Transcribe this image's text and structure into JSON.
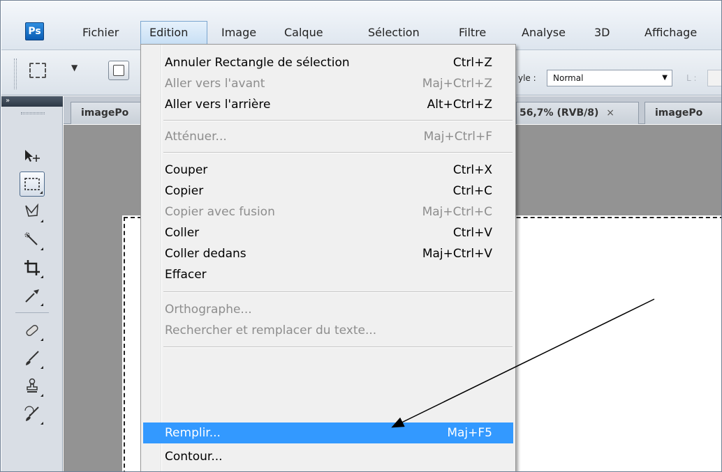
{
  "app": {
    "logo_text": "Ps",
    "menus": [
      "Fichier",
      "Edition",
      "Image",
      "Calque",
      "Sélection",
      "Filtre",
      "Analyse",
      "3D",
      "Affichage"
    ],
    "active_menu": "Edition"
  },
  "options_bar": {
    "style_label": "yle :",
    "style_value": "Normal",
    "width_label": "L :",
    "tool_preset_icon": "rect-marquee-icon",
    "mode_icon": "new-selection-icon"
  },
  "tabs": {
    "left_tab": "imagePo",
    "middle_tab": "56,7% (RVB/8)",
    "middle_tab_close": "×",
    "right_tab": "imagePo"
  },
  "tools_panel": {
    "header": "»",
    "tools": [
      {
        "name": "move-tool-icon",
        "glyph": "▶"
      },
      {
        "name": "rectangular-marquee-tool-icon",
        "glyph": "⬚"
      },
      {
        "name": "lasso-tool-icon",
        "glyph": "ᐯ"
      },
      {
        "name": "quick-selection-tool-icon",
        "glyph": "⁄"
      },
      {
        "name": "crop-tool-icon",
        "glyph": "⌗"
      },
      {
        "name": "eyedropper-tool-icon",
        "glyph": "⁄"
      },
      {
        "name": "healing-brush-tool-icon",
        "glyph": "⊘"
      },
      {
        "name": "brush-tool-icon",
        "glyph": "⁄"
      },
      {
        "name": "clone-stamp-tool-icon",
        "glyph": "♙"
      },
      {
        "name": "history-brush-tool-icon",
        "glyph": "⁄"
      }
    ]
  },
  "edit_menu": {
    "items": [
      {
        "label": "Annuler Rectangle de sélection",
        "shortcut": "Ctrl+Z",
        "enabled": true
      },
      {
        "label": "Aller vers l'avant",
        "shortcut": "Maj+Ctrl+Z",
        "enabled": false
      },
      {
        "label": "Aller vers l'arrière",
        "shortcut": "Alt+Ctrl+Z",
        "enabled": true
      },
      {
        "label": "Atténuer...",
        "shortcut": "Maj+Ctrl+F",
        "enabled": false
      },
      {
        "label": "Couper",
        "shortcut": "Ctrl+X",
        "enabled": true
      },
      {
        "label": "Copier",
        "shortcut": "Ctrl+C",
        "enabled": true
      },
      {
        "label": "Copier avec fusion",
        "shortcut": "Maj+Ctrl+C",
        "enabled": false
      },
      {
        "label": "Coller",
        "shortcut": "Ctrl+V",
        "enabled": true
      },
      {
        "label": "Coller dedans",
        "shortcut": "Maj+Ctrl+V",
        "enabled": true
      },
      {
        "label": "Effacer",
        "shortcut": "",
        "enabled": true
      },
      {
        "label": "Orthographe...",
        "shortcut": "",
        "enabled": false
      },
      {
        "label": "Rechercher et remplacer du texte...",
        "shortcut": "",
        "enabled": false
      },
      {
        "label": "Remplir...",
        "shortcut": "Maj+F5",
        "enabled": true,
        "highlighted": true
      },
      {
        "label": "Contour...",
        "shortcut": "",
        "enabled": true
      }
    ]
  },
  "colors": {
    "highlight": "#3399ff",
    "disabled_text": "#8d8d8d",
    "workspace": "#939393"
  }
}
